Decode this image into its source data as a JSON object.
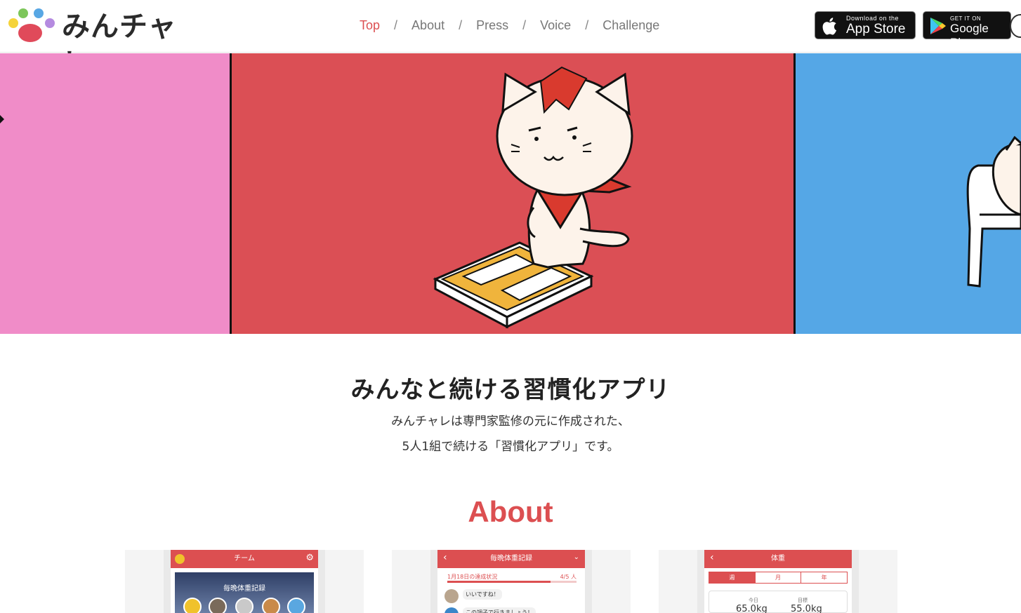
{
  "header": {
    "logo_text": "みんチャレ",
    "nav": [
      {
        "label": "Top",
        "active": true
      },
      {
        "label": "About",
        "active": false
      },
      {
        "label": "Press",
        "active": false
      },
      {
        "label": "Voice",
        "active": false
      },
      {
        "label": "Challenge",
        "active": false
      }
    ],
    "nav_separator": "/",
    "app_store": {
      "small": "Download on the",
      "big": "App Store"
    },
    "google_play": {
      "small": "GET IT ON",
      "big": "Google Play"
    }
  },
  "hero": {
    "colors": {
      "left": "#f08cc8",
      "center": "#db4f55",
      "right": "#55a7e6"
    }
  },
  "intro": {
    "title": "みんなと続ける習慣化アプリ",
    "line1": "みんチャレは専門家監修の元に作成された、",
    "line2": "5人1組で続ける「習慣化アプリ」です。"
  },
  "about": {
    "title": "About",
    "screens": [
      {
        "header": "チーム",
        "banner": "毎晩体重記録"
      },
      {
        "header": "毎晩体重記録",
        "status": "1月18日の達成状況",
        "count": "4/5 人",
        "msg1": "いいですね！",
        "msg2": "この調子で行きましょう！"
      },
      {
        "header": "体重",
        "tabs": [
          "週",
          "月",
          "年"
        ],
        "today_label": "今日",
        "today_value": "65.0kg",
        "goal_label": "目標",
        "goal_value": "55.0kg"
      }
    ]
  },
  "accent_color": "#dc4f51"
}
